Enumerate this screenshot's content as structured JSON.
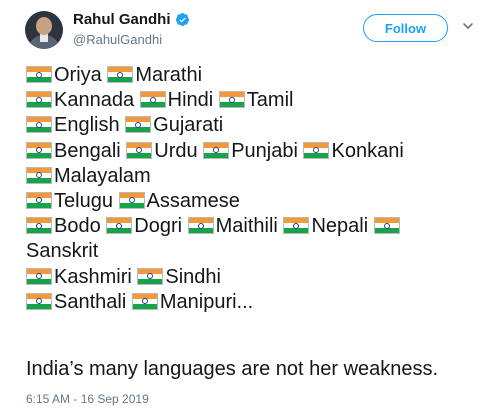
{
  "account": {
    "display_name": "Rahul Gandhi",
    "handle": "@RahulGandhi",
    "verified": true
  },
  "follow_label": "Follow",
  "tweet": {
    "lines": [
      [
        {
          "lang": "Oriya"
        },
        {
          "lang": "Marathi"
        }
      ],
      [
        {
          "lang": "Kannada"
        },
        {
          "lang": "Hindi"
        },
        {
          "lang": "Tamil"
        }
      ],
      [
        {
          "lang": "English"
        },
        {
          "lang": "Gujarati"
        }
      ],
      [
        {
          "lang": "Bengali"
        },
        {
          "lang": "Urdu"
        },
        {
          "lang": "Punjabi"
        },
        {
          "lang": "Konkani"
        }
      ],
      [
        {
          "lang": "Malayalam"
        }
      ],
      [
        {
          "lang": "Telugu"
        },
        {
          "lang": "Assamese"
        }
      ],
      [
        {
          "lang": "Bodo"
        },
        {
          "lang": "Dogri"
        },
        {
          "lang": "Maithili"
        },
        {
          "lang": "Nepali"
        },
        {
          "flag_only": true
        }
      ],
      [
        {
          "lang": "Sanskrit",
          "no_flag": true
        }
      ],
      [
        {
          "lang": "Kashmiri"
        },
        {
          "lang": "Sindhi"
        }
      ],
      [
        {
          "lang": "Santhali"
        },
        {
          "lang": "Manipuri..."
        }
      ]
    ],
    "statement": "India’s many languages are not her weakness.",
    "timestamp": "6:15 AM - 16 Sep 2019"
  },
  "icons": {
    "verified": "verified-badge-icon",
    "flag": "india-flag-icon",
    "chevron": "chevron-down-icon"
  },
  "colors": {
    "accent": "#1da1f2",
    "saffron": "#f2993a",
    "green": "#16a34a",
    "chakra": "#1a3f9a",
    "secondary_text": "#657786"
  }
}
